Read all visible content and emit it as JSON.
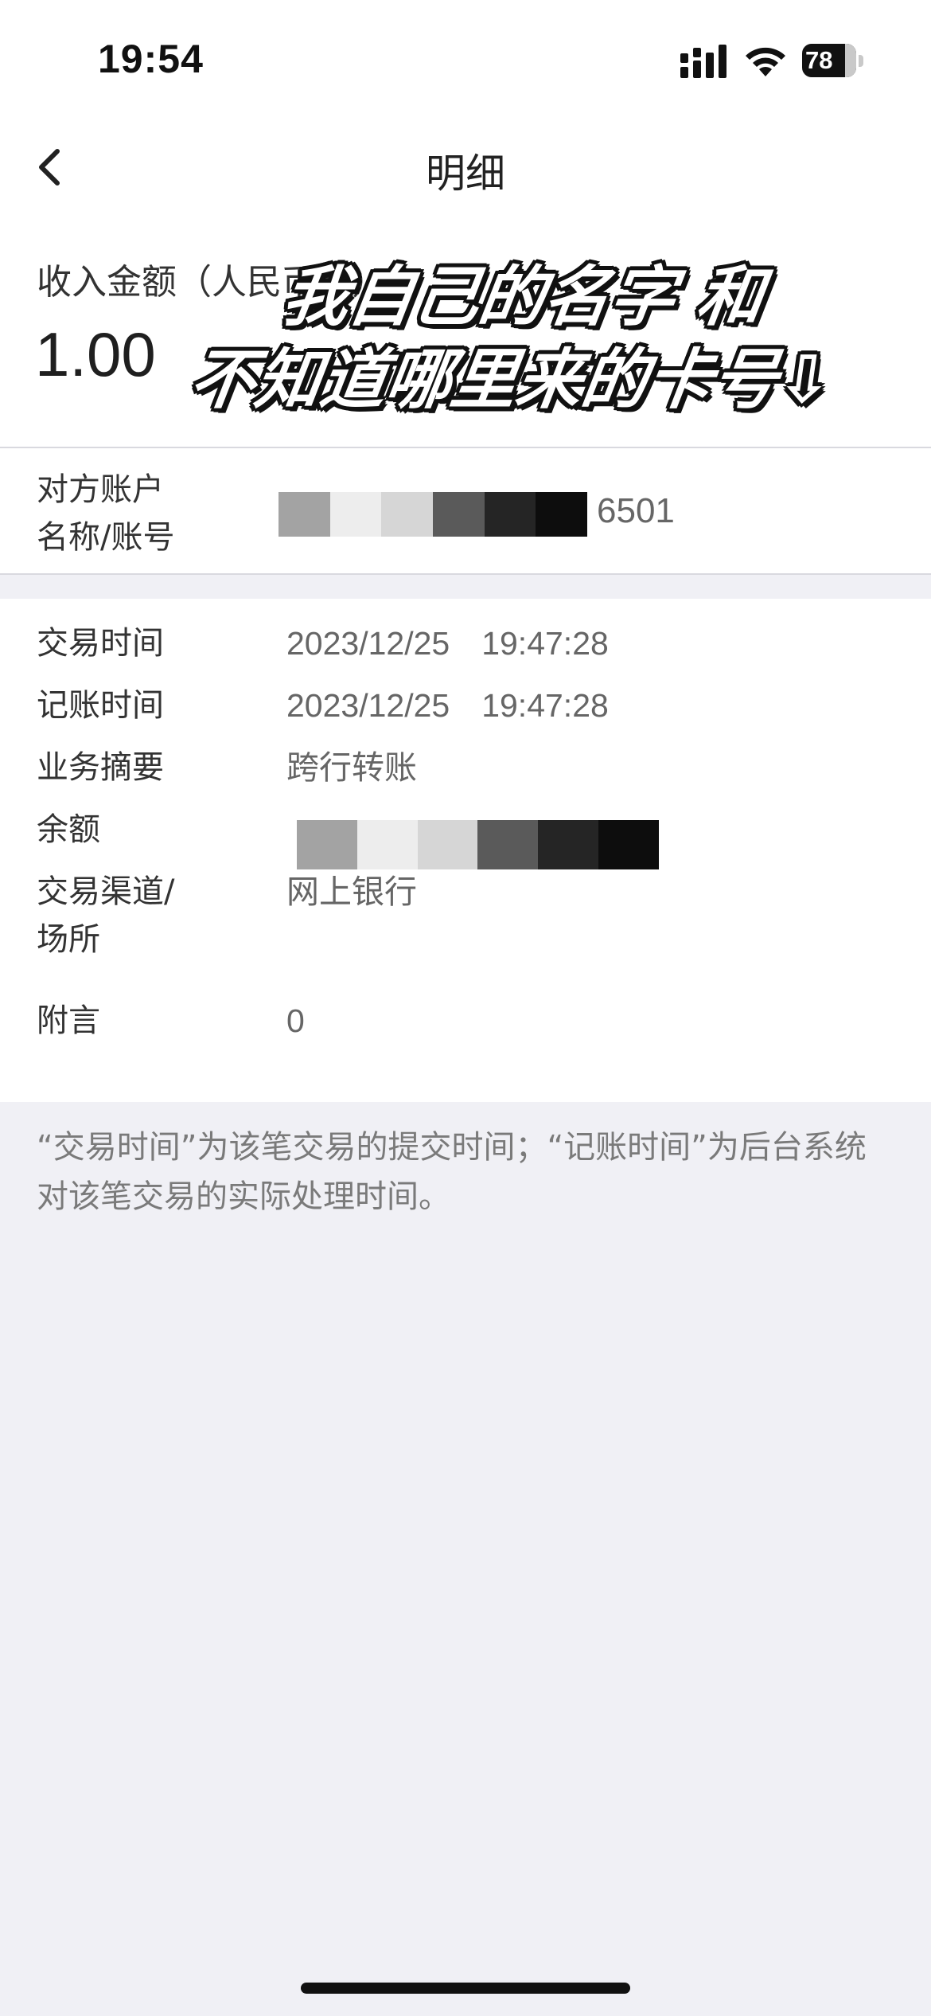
{
  "status_bar": {
    "time": "19:54",
    "battery_level": "78",
    "icons": [
      "signal-icon",
      "wifi-icon",
      "battery-icon"
    ]
  },
  "nav": {
    "back_icon": "chevron-left-icon",
    "title": "明细"
  },
  "amount": {
    "label": "收入金额（人民币元）",
    "value": "1.00"
  },
  "overlay_caption": {
    "line1": "我自己的名字 和",
    "line2": "不知道哪里来的卡号⇩"
  },
  "counterparty": {
    "label_line1": "对方账户",
    "label_line2": "名称/账号",
    "account_suffix": "6501",
    "mask_colors": [
      "#a3a3a3",
      "#ededed",
      "#d6d6d6",
      "#5a5a5a",
      "#252525",
      "#0d0d0d"
    ]
  },
  "details": [
    {
      "label": "交易时间",
      "date": "2023/12/25",
      "time": "19:47:28"
    },
    {
      "label": "记账时间",
      "date": "2023/12/25",
      "time": "19:47:28"
    },
    {
      "label": "业务摘要",
      "value": "跨行转账"
    },
    {
      "label": "余额",
      "masked": true
    },
    {
      "label_line1": "交易渠道/",
      "label_line2": "场所",
      "value": "网上银行"
    },
    {
      "label": "附言",
      "value": "0"
    }
  ],
  "balance_mask_colors": [
    "#a3a3a3",
    "#ededed",
    "#d6d6d6",
    "#5a5a5a",
    "#252525",
    "#0d0d0d"
  ],
  "footnote": "“交易时间”为该笔交易的提交时间；“记账时间”为后台系统对该笔交易的实际处理时间。"
}
